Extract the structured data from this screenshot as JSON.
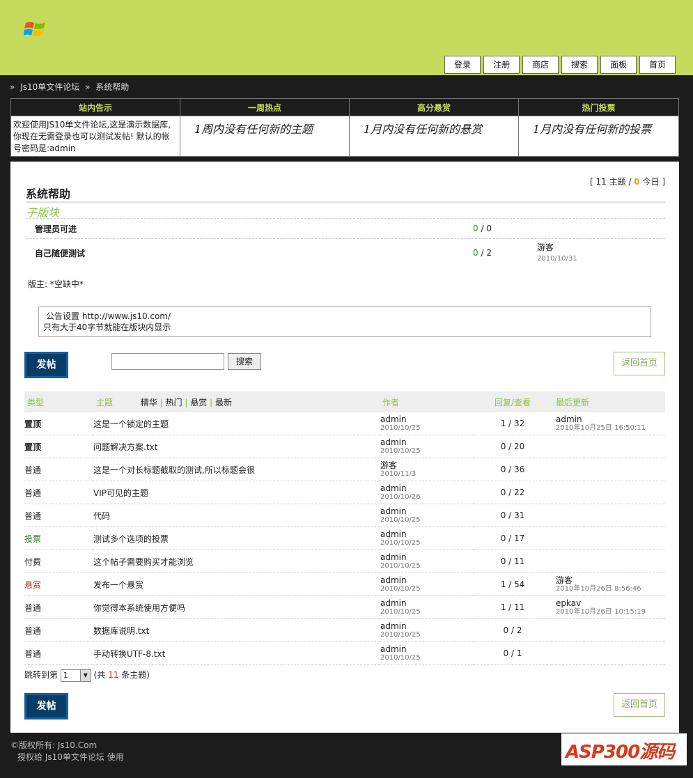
{
  "nav": [
    "登录",
    "注册",
    "商店",
    "搜索",
    "面板",
    "首页"
  ],
  "breadcrumb": [
    "»",
    "Js10单文件论坛",
    "»",
    "系统帮助"
  ],
  "notice": {
    "headers": [
      "站内告示",
      "一周热点",
      "高分悬赏",
      "热门投票"
    ],
    "announcement": "欢迎使用JS10单文件论坛,这是演示数据库,你现在无需登录也可以测试发帖! 默认的帐号密码是:admin",
    "hot": "1周内没有任何新的主题",
    "reward": "1月内没有任何新的悬赏",
    "poll": "1月内没有任何新的投票"
  },
  "board": {
    "stats_open": "[",
    "topics": "11",
    "topics_label": "主题 /",
    "today": "0",
    "today_label": "今日",
    "stats_close": "]",
    "title": "系统帮助",
    "sub_title": "子版块",
    "subforums": [
      {
        "name": "管理员可进",
        "count_a": "0",
        "count_b": "/ 0",
        "last_user": "",
        "last_date": ""
      },
      {
        "name": "自己随便测试",
        "count_a": "0",
        "count_b": "/ 2",
        "last_user": "游客",
        "last_date": "2010/10/31"
      }
    ],
    "moderator_label": "版主:",
    "moderator": "*空缺中*",
    "announcement_line1": "公告设置 http://www.js10.com/",
    "announcement_line2": "只有大于40字节就能在版块内显示",
    "post_button": "发帖",
    "search_button": "搜索",
    "search_value": "",
    "back_button": "返回首页"
  },
  "table": {
    "headers": {
      "type": "类型",
      "topic": "主题",
      "filter_digest": "精华",
      "filter_hot": "热门",
      "filter_reward": "悬赏",
      "filter_new": "最新",
      "sep": "|",
      "author": "作者",
      "replies": "回复/查看",
      "last": "最后更新"
    },
    "rows": [
      {
        "type": "置顶",
        "topic": "这是一个锁定的主题",
        "author": "admin",
        "date": "2010/10/25",
        "stats": "1 / 32",
        "last_user": "admin",
        "last_date": "2010年10月25日 16:50:11"
      },
      {
        "type": "置顶",
        "topic": "问题解决方案.txt",
        "author": "admin",
        "date": "2010/10/25",
        "stats": "0 / 20",
        "last_user": "",
        "last_date": ""
      },
      {
        "type": "普通",
        "topic": "这是一个对长标题截取的测试,所以标题会很",
        "author": "游客",
        "date": "2010/11/3",
        "stats": "0 / 36",
        "last_user": "",
        "last_date": ""
      },
      {
        "type": "普通",
        "topic": "VIP可见的主题",
        "author": "admin",
        "date": "2010/10/26",
        "stats": "0 / 22",
        "last_user": "",
        "last_date": ""
      },
      {
        "type": "普通",
        "topic": "代码",
        "author": "admin",
        "date": "2010/10/25",
        "stats": "0 / 31",
        "last_user": "",
        "last_date": ""
      },
      {
        "type": "投票",
        "topic": "测试多个选项的投票",
        "author": "admin",
        "date": "2010/10/25",
        "stats": "0 / 17",
        "last_user": "",
        "last_date": ""
      },
      {
        "type": "付费",
        "topic": "这个帖子需要购买才能浏览",
        "author": "admin",
        "date": "2010/10/25",
        "stats": "0 / 11",
        "last_user": "",
        "last_date": ""
      },
      {
        "type": "悬赏",
        "topic": "发布一个悬赏",
        "author": "admin",
        "date": "2010/10/25",
        "stats": "1 / 54",
        "last_user": "游客",
        "last_date": "2010年10月26日 8:56:46"
      },
      {
        "type": "普通",
        "topic": "你觉得本系统使用方便吗",
        "author": "admin",
        "date": "2010/10/25",
        "stats": "1 / 11",
        "last_user": "epkav",
        "last_date": "2010年10月26日 10:15:19"
      },
      {
        "type": "普通",
        "topic": "数据库说明.txt",
        "author": "admin",
        "date": "2010/10/25",
        "stats": "0 / 2",
        "last_user": "",
        "last_date": ""
      },
      {
        "type": "普通",
        "topic": "手动转换UTF-8.txt",
        "author": "admin",
        "date": "2010/10/25",
        "stats": "0 / 1",
        "last_user": "",
        "last_date": ""
      }
    ]
  },
  "pager": {
    "label": "跳转到第",
    "page": "1",
    "total_open": "(共",
    "total": "11",
    "total_close": "条主题)"
  },
  "footer": {
    "line1": "©版权所有: Js10.Com",
    "line2": "授权给 Js10单文件论坛 使用"
  },
  "watermark": "ASP300源码",
  "colors": {
    "header_bg": "#c6da5e",
    "page_bg": "#1c1c1c",
    "accent_green": "#8cc43f",
    "vote": "#2a7a2a",
    "reward": "#c0392b",
    "today": "#e6a700"
  }
}
